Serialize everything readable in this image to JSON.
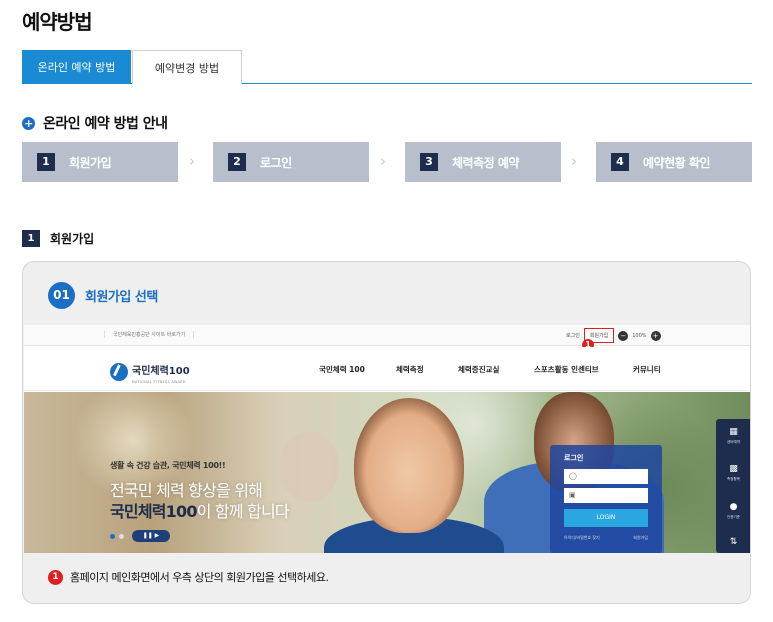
{
  "page_title": "예약방법",
  "tabs": [
    {
      "label": "온라인 예약 방법",
      "active": true
    },
    {
      "label": "예약변경 방법",
      "active": false
    }
  ],
  "guide": {
    "title": "온라인 예약 방법 안내",
    "steps": [
      {
        "num": "1",
        "label": "회원가입"
      },
      {
        "num": "2",
        "label": "로그인"
      },
      {
        "num": "3",
        "label": "체력측정 예약"
      },
      {
        "num": "4",
        "label": "예약현황 확인"
      }
    ],
    "chevron": "›"
  },
  "section": {
    "num": "1",
    "label": "회원가입"
  },
  "card": {
    "num": "01",
    "title": "회원가입 선택",
    "caption_num": "1",
    "caption": "홈페이지 메인화면에서 우측 상단의 회원가입을 선택하세요."
  },
  "screenshot": {
    "util_left": "국민체육진흥공단 사이트 바로가기",
    "util_login": "로그인",
    "util_join": "회원가입",
    "zoom_minus": "−",
    "zoom_level": "100%",
    "zoom_plus": "+",
    "marker": "1",
    "logo_text": "국민체력100",
    "logo_sub": "NATIONAL FITNESS AWARD",
    "nav": [
      "국민체력 100",
      "체력측정",
      "체력증진교실",
      "스포츠활동 인센티브",
      "커뮤니티"
    ],
    "hero_sub": "생활 속 건강 습관, 국민체력 100!!",
    "hero_line1": "전국민 체력 향상을 위해",
    "hero_line2_bold": "국민체력100",
    "hero_line2_rest": "이 함께 합니다",
    "pager": "❚❚ ▶",
    "login_title": "로그인",
    "login_user_icon": "user-icon",
    "login_pw_icon": "lock-icon",
    "login_button": "LOGIN",
    "login_link1": "아이디/비밀번호 찾기",
    "login_link2": "회원가입",
    "rail": [
      {
        "icon": "calendar-icon",
        "label": "센터예약"
      },
      {
        "icon": "clipboard-icon",
        "label": "측정항목"
      },
      {
        "icon": "medal-icon",
        "label": "인증기준"
      },
      {
        "icon": "settings-icon",
        "label": ""
      }
    ]
  },
  "colors": {
    "primary": "#1a8ad4",
    "navy": "#1e2d4d",
    "step_bg": "#b7bfcc",
    "accent_red": "#e02020"
  }
}
